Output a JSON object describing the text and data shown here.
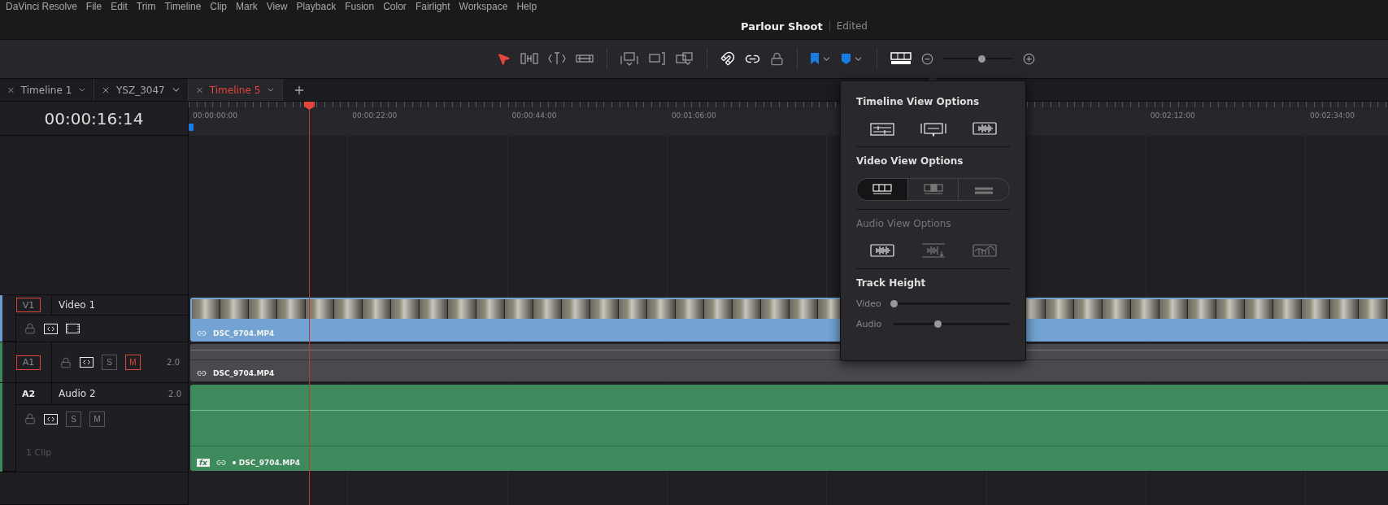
{
  "menu": [
    "DaVinci Resolve",
    "File",
    "Edit",
    "Trim",
    "Timeline",
    "Clip",
    "Mark",
    "View",
    "Playback",
    "Fusion",
    "Color",
    "Fairlight",
    "Workspace",
    "Help"
  ],
  "project": {
    "title": "Parlour Shoot",
    "status": "Edited"
  },
  "toolbar": {
    "edit_modes": [
      {
        "kind": "selection",
        "selected": true
      },
      {
        "kind": "trim",
        "selected": false
      },
      {
        "kind": "dynamic-trim",
        "selected": false
      },
      {
        "kind": "blade",
        "selected": false
      }
    ],
    "edit_actions": [
      {
        "kind": "insert"
      },
      {
        "kind": "overwrite"
      },
      {
        "kind": "replace"
      }
    ],
    "toggles": [
      {
        "kind": "snapping",
        "on": true
      },
      {
        "kind": "linked-selection",
        "on": true
      },
      {
        "kind": "position-lock",
        "on": false
      }
    ],
    "view_options_open": true,
    "zoom": {
      "level": 0.55
    }
  },
  "tabs": [
    {
      "label": "Timeline 1",
      "selected": false
    },
    {
      "label": "YSZ_3047",
      "selected": false
    },
    {
      "label": "Timeline 5",
      "selected": true
    }
  ],
  "timecode": "00:00:16:14",
  "ruler": {
    "labels_left": [
      "00:00:00:00",
      "00:00:22:00",
      "00:00:44:00",
      "00:01:06:00"
    ],
    "labels_right": [
      "00:02:12:00",
      "00:02:34:00"
    ]
  },
  "tracks": [
    {
      "kind": "video",
      "id_label": "V1",
      "name": "Video 1",
      "destination": true,
      "locked": false,
      "auto_select": true,
      "clip": {
        "name": "DSC_9704.MP4"
      }
    },
    {
      "kind": "audio",
      "id_label": "A1",
      "destination": true,
      "locked": false,
      "auto_select": true,
      "solo": {
        "label": "S",
        "on": false
      },
      "mute": {
        "label": "M",
        "on": true
      },
      "channels": "2.0",
      "clip": {
        "name": "DSC_9704.MP4"
      }
    },
    {
      "kind": "audio",
      "id_label": "A2",
      "name": "Audio 2",
      "destination": false,
      "locked": false,
      "auto_select": true,
      "solo": {
        "label": "S",
        "on": false
      },
      "mute": {
        "label": "M",
        "on": false
      },
      "channels": "2.0",
      "clip_count": "1 Clip",
      "clip": {
        "name": "DSC_9704.MP4",
        "effect": "fx"
      }
    }
  ],
  "view_options": {
    "sections": [
      {
        "kind": "toggles",
        "title": "Timeline View Options",
        "disabled": false,
        "options": [
          {
            "kind": "stacked",
            "selected": true
          },
          {
            "kind": "subtitles",
            "selected": true
          },
          {
            "kind": "waveform",
            "selected": true
          }
        ]
      },
      {
        "kind": "segmented",
        "title": "Video View Options",
        "disabled": false,
        "options": [
          {
            "kind": "filmstrip",
            "selected": true
          },
          {
            "kind": "thumbnail",
            "selected": false
          },
          {
            "kind": "simple",
            "selected": false
          }
        ]
      },
      {
        "kind": "toggles",
        "title": "Audio View Options",
        "disabled": true,
        "options": [
          {
            "kind": "waveform",
            "selected": true
          },
          {
            "kind": "waveform-down",
            "selected": false
          },
          {
            "kind": "envelope",
            "selected": false
          }
        ]
      },
      {
        "kind": "sliders",
        "title": "Track Height",
        "disabled": false,
        "sliders": [
          {
            "label": "Video",
            "level": 0
          },
          {
            "label": "Audio",
            "level": 0.38
          }
        ]
      }
    ]
  }
}
